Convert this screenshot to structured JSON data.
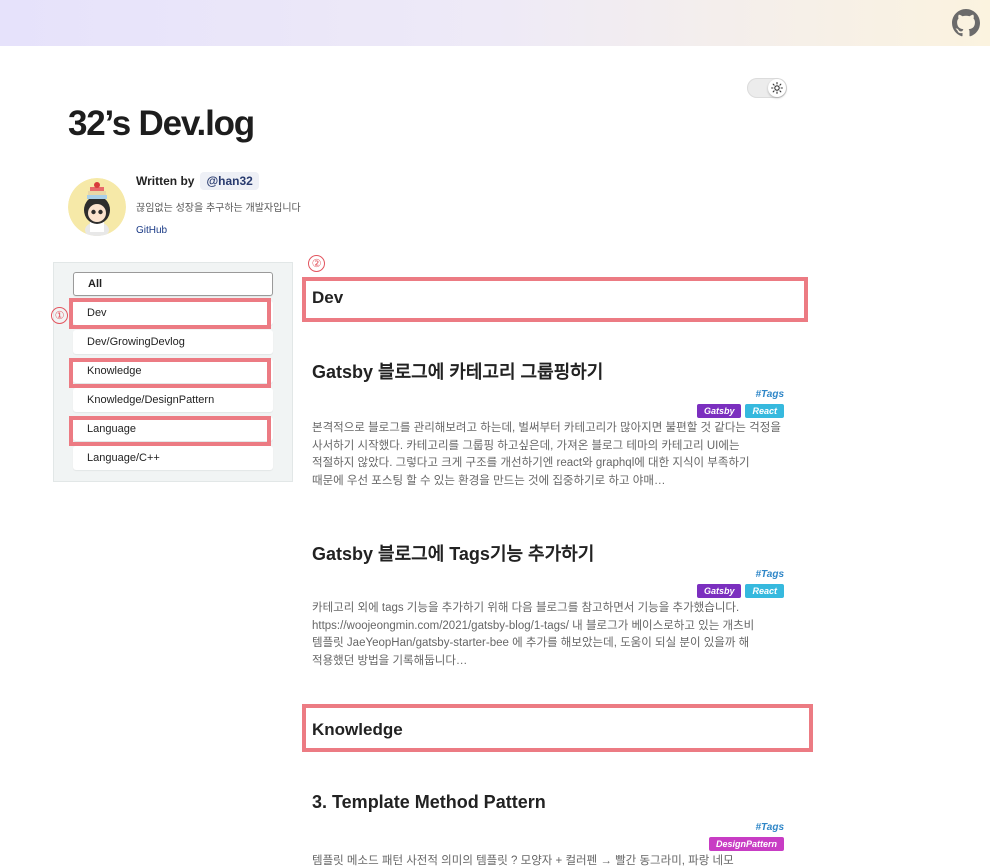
{
  "header": {
    "github_icon": "github-icon"
  },
  "theme_toggle": {
    "icon": "sun-icon"
  },
  "blog": {
    "title": "32’s Dev.log"
  },
  "bio": {
    "written_by": "Written by",
    "handle": "@han32",
    "description": "끊임없는 성장을 추구하는 개발자입니다",
    "link": "GitHub"
  },
  "categories": [
    "All",
    "Dev",
    "Dev/GrowingDevlog",
    "Knowledge",
    "Knowledge/DesignPattern",
    "Language",
    "Language/C++"
  ],
  "annotations": [
    "①",
    "②"
  ],
  "sections": [
    {
      "heading": "Dev",
      "posts": [
        {
          "title": "Gatsby 블로그에 카테고리 그룹핑하기",
          "tags_label": "#Tags",
          "tags": [
            "Gatsby",
            "React"
          ],
          "excerpt": "본격적으로 블로그를 관리해보려고 하는데, 벌써부터 카테고리가 많아지면 불편할 것 같다는 걱정을 사서하기 시작했다. 카테고리를 그룹핑 하고싶은데, 가져온 블로그 테마의 카테고리 UI에는 적절하지 않았다. 그렇다고 크게 구조를 개선하기엔 react와 graphql에 대한 지식이 부족하기 때문에 우선 포스팅 할 수 있는 환경을 만드는 것에 집중하기로 하고 야매…"
        },
        {
          "title": "Gatsby 블로그에 Tags기능 추가하기",
          "tags_label": "#Tags",
          "tags": [
            "Gatsby",
            "React"
          ],
          "excerpt": "카테고리 외에 tags 기능을 추가하기 위해 다음 블로그를 참고하면서 기능을 추가했습니다. https://woojeongmin.com/2021/gatsby-blog/1-tags/ 내 블로그가 베이스로하고 있는 개츠비 템플릿 JaeYeopHan/gatsby-starter-bee 에 추가를 해보았는데, 도움이 되실 분이 있을까 해 적용했던 방법을 기록해둡니다…"
        }
      ]
    },
    {
      "heading": "Knowledge",
      "posts": [
        {
          "title": "3. Template Method Pattern",
          "tags_label": "#Tags",
          "tags": [
            "DesignPattern"
          ],
          "excerpt": "템플릿 메소드 패턴 사전적 의미의 템플릿 ? 모양자 + 컬러펜 → 빨간 동그라미, 파랑 네모"
        }
      ]
    }
  ],
  "tag_colors": {
    "Gatsby": "#7b2fbf",
    "React": "#36b9de",
    "DesignPattern": "#c83cc4"
  },
  "highlight_color": "#ec7b83"
}
